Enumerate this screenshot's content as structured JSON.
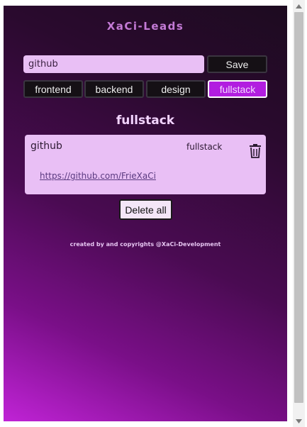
{
  "app": {
    "title": "XaCi-Leads"
  },
  "input": {
    "value": "github",
    "save_label": "Save"
  },
  "categories": [
    {
      "label": "frontend",
      "active": false
    },
    {
      "label": "backend",
      "active": false
    },
    {
      "label": "design",
      "active": false
    },
    {
      "label": "fullstack",
      "active": true
    }
  ],
  "section": {
    "title": "fullstack"
  },
  "leads": [
    {
      "name": "github",
      "category": "fullstack",
      "url": "https://github.com/FrieXaCi"
    }
  ],
  "actions": {
    "delete_all_label": "Delete all"
  },
  "footer": {
    "text": "created by and copyrights @XaCi-Development"
  },
  "colors": {
    "accent": "#b21de0",
    "card": "#e9bff5",
    "title": "#c47ad6"
  },
  "icons": {
    "delete": "trash-icon"
  }
}
